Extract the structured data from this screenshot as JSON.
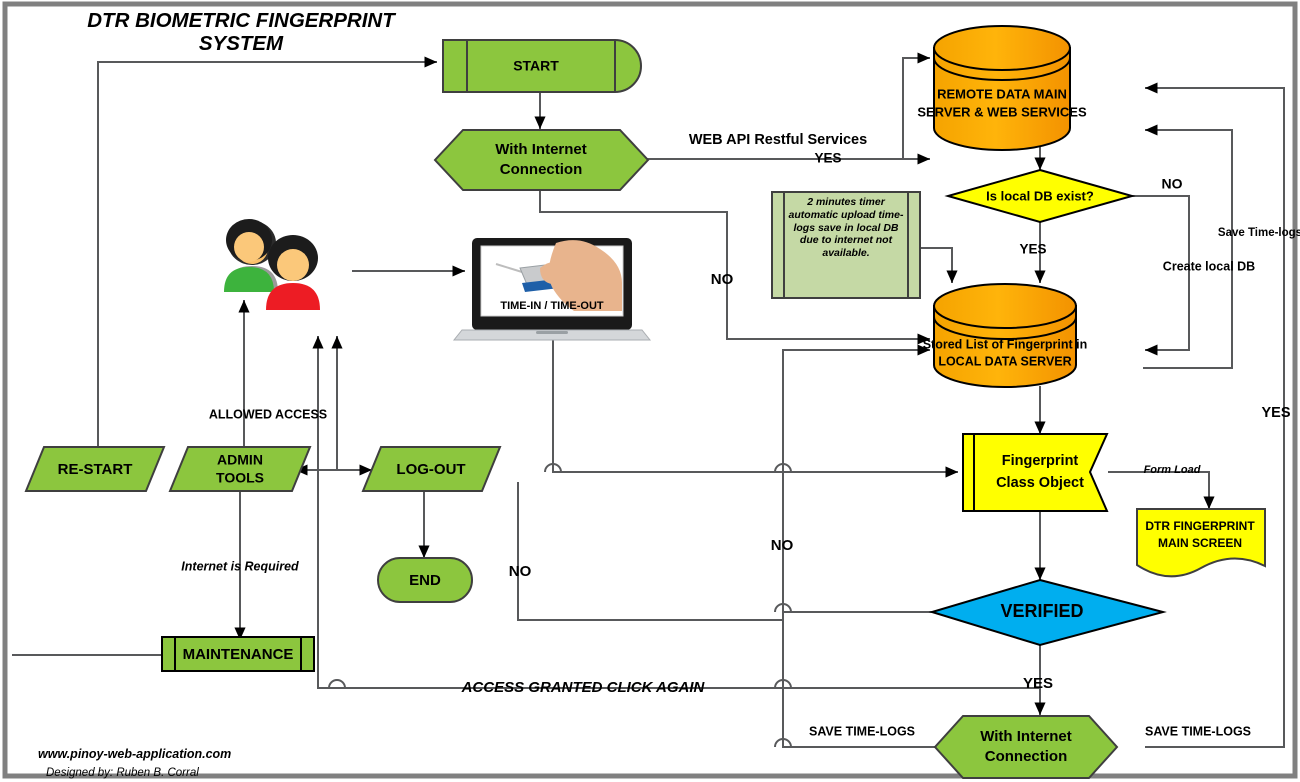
{
  "title": {
    "line1": "DTR BIOMETRIC FINGERPRINT",
    "line2": "SYSTEM"
  },
  "footer": {
    "website": "www.pinoy-web-application.com",
    "credit": "Designed by: Ruben B. Corral"
  },
  "colors": {
    "green": "#8CC63E",
    "orange": "#FFA800",
    "yellow": "#FFFF00",
    "cyan": "#00AEEF",
    "note_green": "#C5D9A5",
    "line": "#58595B",
    "black": "#000000",
    "frame": "#808080"
  },
  "nodes": {
    "start": {
      "label": "START",
      "shape": "delay-capsule",
      "fill": "#8CC63E"
    },
    "with_internet_top": {
      "label_line1": "With Internet",
      "label_line2": "Connection",
      "shape": "hexagon",
      "fill": "#8CC63E"
    },
    "remote_server": {
      "label_line1": "REMOTE DATA MAIN",
      "label_line2": "SERVER & WEB SERVICES",
      "shape": "cylinder",
      "fill": "#FFA800"
    },
    "is_local_db": {
      "label": "Is local DB exist?",
      "shape": "diamond",
      "fill": "#FFFF00"
    },
    "timer_note": {
      "label": "2 minutes timer automatic upload time-logs save in local DB due to internet not available.",
      "shape": "predefined-process",
      "fill": "#C5D9A5"
    },
    "local_server": {
      "label_line1": "Stored List of Fingerprint in",
      "label_line2": "LOCAL DATA SERVER",
      "shape": "cylinder",
      "fill": "#FFA800"
    },
    "fingerprint_class": {
      "label_line1": "Fingerprint",
      "label_line2": "Class Object",
      "shape": "flag-banner",
      "fill": "#FFFF00"
    },
    "dtr_main_screen": {
      "label_line1": "DTR FINGERPRINT",
      "label_line2": "MAIN SCREEN",
      "shape": "document",
      "fill": "#FFFF00"
    },
    "verified": {
      "label": "VERIFIED",
      "shape": "diamond",
      "fill": "#00AEEF"
    },
    "with_internet_bottom": {
      "label_line1": "With Internet",
      "label_line2": "Connection",
      "shape": "hexagon",
      "fill": "#8CC63E"
    },
    "restart": {
      "label": "RE-START",
      "shape": "parallelogram",
      "fill": "#8CC63E"
    },
    "admin_tools": {
      "label_line1": "ADMIN",
      "label_line2": "TOOLS",
      "shape": "parallelogram",
      "fill": "#8CC63E"
    },
    "logout": {
      "label": "LOG-OUT",
      "shape": "parallelogram",
      "fill": "#8CC63E"
    },
    "end": {
      "label": "END",
      "shape": "rounded-terminator",
      "fill": "#8CC63E"
    },
    "maintenance": {
      "label": "MAINTENANCE",
      "shape": "predefined-process",
      "fill": "#8CC63E"
    },
    "users": {
      "label": "users-group-icon",
      "shape": "image"
    },
    "laptop": {
      "label": "TIME-IN / TIME-OUT",
      "shape": "image-laptop-fingerprint-scanner"
    }
  },
  "edge_labels": {
    "web_api": "WEB API Restful Services",
    "yes_web_api": "YES",
    "no_internet": "NO",
    "yes_local_db": "YES",
    "no_local_db": "NO",
    "create_local_db": "Create local DB",
    "save_time_logs_right": "Save Time-logs",
    "yes_far_right": "YES",
    "form_load": "Form Load",
    "no_verified": "NO",
    "yes_verified": "YES",
    "save_time_logs_left": "SAVE TIME-LOGS",
    "save_time_logs_right2": "SAVE TIME-LOGS",
    "allowed_access": "ALLOWED ACCESS",
    "internet_required": "Internet is Required",
    "no_left": "NO",
    "access_granted": "ACCESS GRANTED CLICK AGAIN"
  }
}
